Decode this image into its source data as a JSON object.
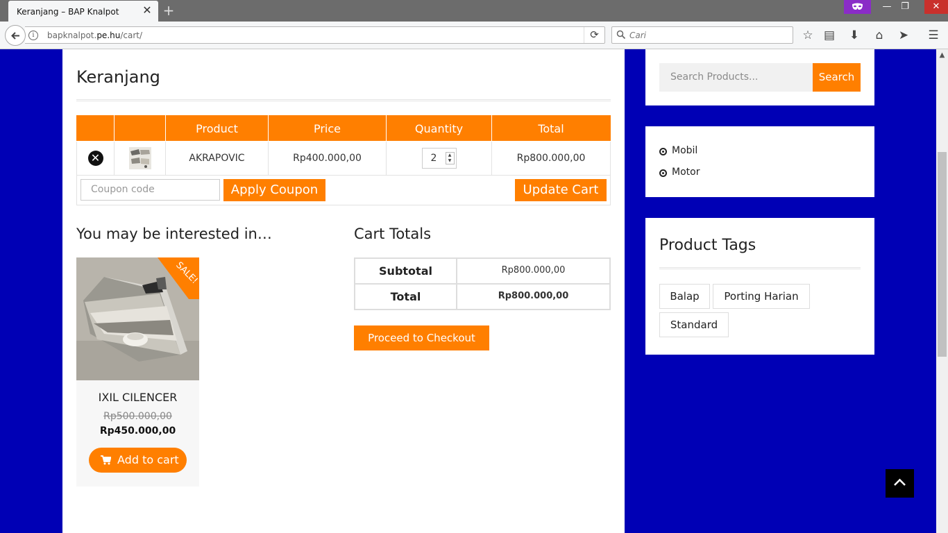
{
  "browser": {
    "tab_title": "Keranjang – BAP Knalpot",
    "url_host_prefix": "bapknalpot.",
    "url_host_main": "pe.hu",
    "url_path": "/cart/",
    "search_placeholder": "Cari"
  },
  "page": {
    "title": "Keranjang"
  },
  "cart": {
    "headers": [
      "",
      "",
      "Product",
      "Price",
      "Quantity",
      "Total"
    ],
    "items": [
      {
        "product": "AKRAPOVIC",
        "price": "Rp400.000,00",
        "quantity": "2",
        "total": "Rp800.000,00"
      }
    ],
    "coupon_placeholder": "Coupon code",
    "apply_label": "Apply Coupon",
    "update_label": "Update Cart"
  },
  "cross_sells": {
    "heading": "You may be interested in…",
    "product": {
      "sale_badge": "SALE!",
      "name": "IXIL CILENCER",
      "old_price": "Rp500.000,00",
      "new_price": "Rp450.000,00",
      "button_label": "Add to cart"
    }
  },
  "totals": {
    "heading": "Cart Totals",
    "subtotal_label": "Subtotal",
    "subtotal_value": "Rp800.000,00",
    "total_label": "Total",
    "total_value": "Rp800.000,00",
    "checkout_label": "Proceed to Checkout"
  },
  "sidebar": {
    "search_placeholder": "Search Products...",
    "search_button": "Search",
    "categories": [
      "Mobil",
      "Motor"
    ],
    "tags_title": "Product Tags",
    "tags": [
      "Balap",
      "Porting Harian",
      "Standard"
    ]
  },
  "colors": {
    "accent": "#ff7f00",
    "background": "#0000b5",
    "panel": "#ffffff"
  }
}
